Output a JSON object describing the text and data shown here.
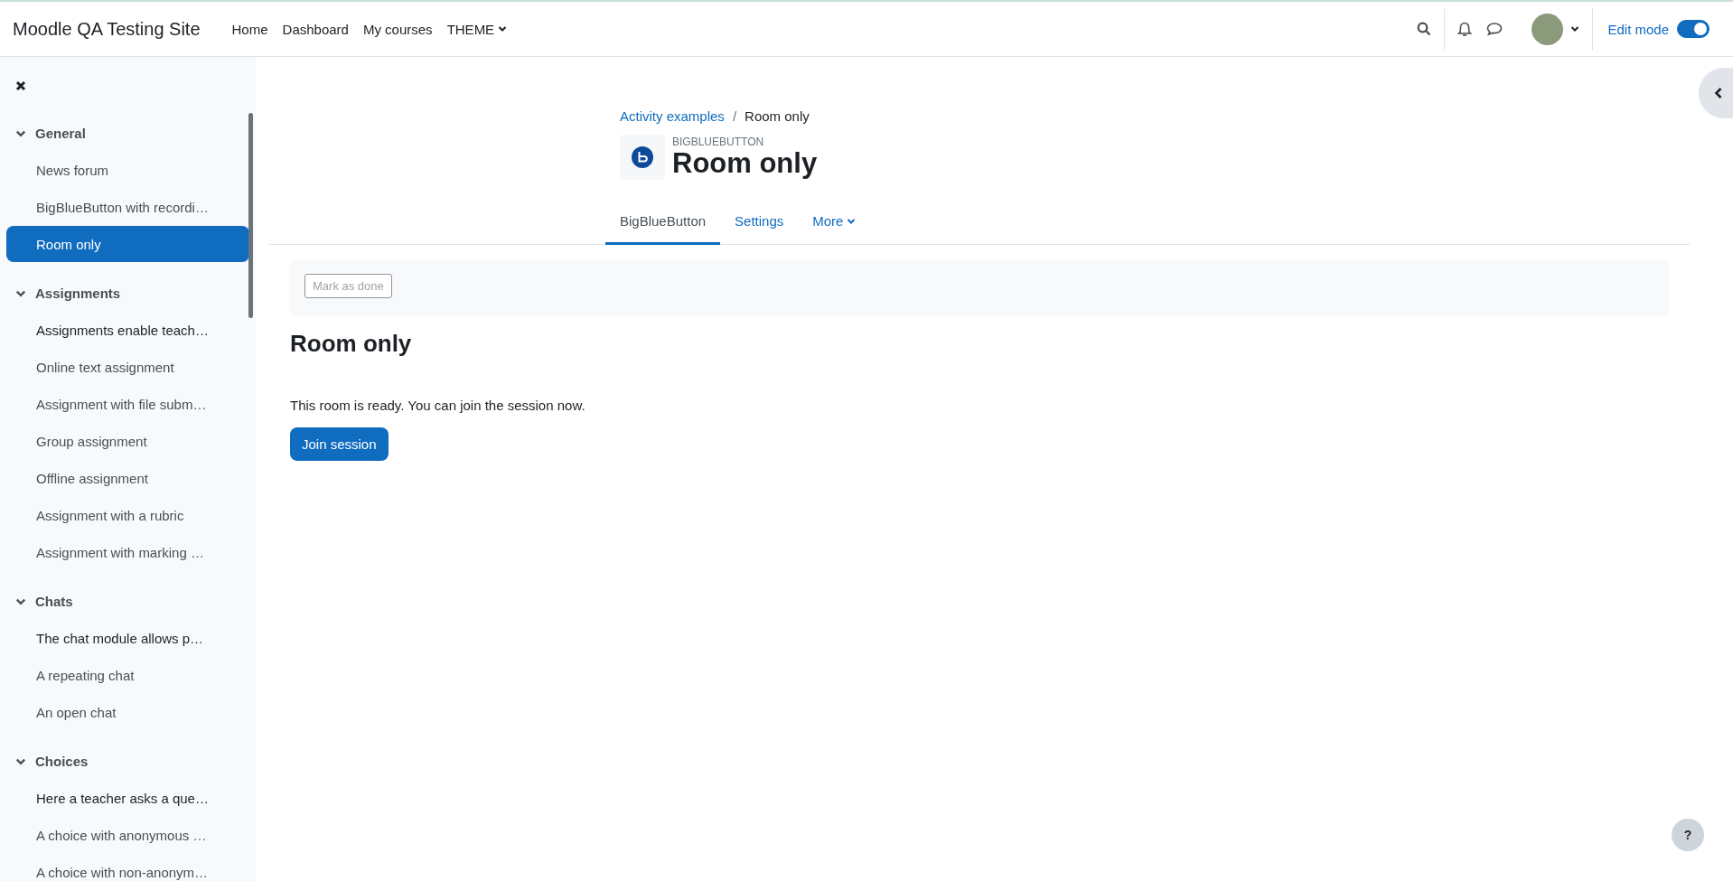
{
  "navbar": {
    "site_name": "Moodle QA Testing Site",
    "links": [
      {
        "label": "Home",
        "dropdown": false
      },
      {
        "label": "Dashboard",
        "dropdown": false
      },
      {
        "label": "My courses",
        "dropdown": false
      },
      {
        "label": "THEME",
        "dropdown": true
      }
    ],
    "edit_mode": {
      "label": "Edit mode",
      "on": true
    }
  },
  "course_index": {
    "sections": [
      {
        "title": "General",
        "expanded": true,
        "items": [
          {
            "label": "News forum",
            "kind": "link",
            "selected": false
          },
          {
            "label": "BigBlueButton with recordi…",
            "kind": "link",
            "selected": false
          },
          {
            "label": "Room only",
            "kind": "link",
            "selected": true
          }
        ]
      },
      {
        "title": "Assignments",
        "expanded": true,
        "items": [
          {
            "label": "Assignments enable teach…",
            "kind": "label",
            "selected": false
          },
          {
            "label": "Online text assignment",
            "kind": "link",
            "selected": false
          },
          {
            "label": "Assignment with file subm…",
            "kind": "link",
            "selected": false
          },
          {
            "label": "Group assignment",
            "kind": "link",
            "selected": false
          },
          {
            "label": "Offline assignment",
            "kind": "link",
            "selected": false
          },
          {
            "label": "Assignment with a rubric",
            "kind": "link",
            "selected": false
          },
          {
            "label": "Assignment with marking …",
            "kind": "link",
            "selected": false
          }
        ]
      },
      {
        "title": "Chats",
        "expanded": true,
        "items": [
          {
            "label": "The chat module allows p…",
            "kind": "label",
            "selected": false
          },
          {
            "label": "A repeating chat",
            "kind": "link",
            "selected": false
          },
          {
            "label": "An open chat",
            "kind": "link",
            "selected": false
          }
        ]
      },
      {
        "title": "Choices",
        "expanded": true,
        "items": [
          {
            "label": "Here a teacher asks a que…",
            "kind": "label",
            "selected": false
          },
          {
            "label": "A choice with anonymous …",
            "kind": "link",
            "selected": false
          },
          {
            "label": "A choice with non-anonym…",
            "kind": "link",
            "selected": false
          }
        ]
      }
    ]
  },
  "breadcrumb": {
    "separator": "/",
    "items": [
      {
        "label": "Activity examples",
        "link": true
      },
      {
        "label": "Room only",
        "link": false
      }
    ]
  },
  "activity_header": {
    "module_type": "BIGBLUEBUTTON",
    "title": "Room only"
  },
  "tabs": [
    {
      "label": "BigBlueButton",
      "selected": true,
      "dropdown": false
    },
    {
      "label": "Settings",
      "selected": false,
      "dropdown": false
    },
    {
      "label": "More",
      "selected": false,
      "dropdown": true
    }
  ],
  "completion": {
    "label": "Mark as done",
    "disabled": true
  },
  "content": {
    "heading": "Room only",
    "message": "This room is ready. You can join the session now.",
    "button": "Join session"
  },
  "help_button": "?"
}
